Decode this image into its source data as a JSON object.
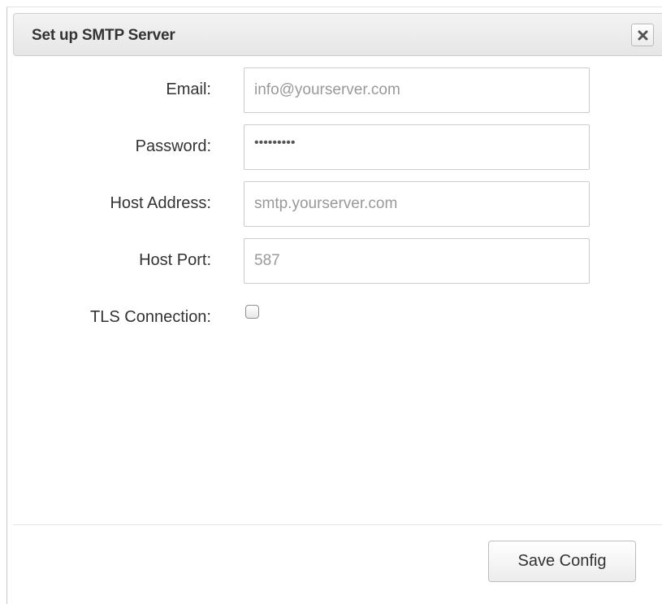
{
  "dialog": {
    "title": "Set up SMTP Server",
    "close_icon": "close-icon"
  },
  "form": {
    "email": {
      "label": "Email:",
      "placeholder": "info@yourserver.com",
      "value": ""
    },
    "password": {
      "label": "Password:",
      "masked_value": "•••••••••"
    },
    "host_address": {
      "label": "Host Address:",
      "placeholder": "smtp.yourserver.com",
      "value": ""
    },
    "host_port": {
      "label": "Host Port:",
      "placeholder": "587",
      "value": ""
    },
    "tls_connection": {
      "label": "TLS Connection:",
      "checked": false
    }
  },
  "footer": {
    "save_label": "Save Config"
  },
  "colors": {
    "text": "#333333",
    "placeholder": "#999999",
    "border": "#cccccc",
    "titlebar_bg": "#e9e9e9"
  }
}
